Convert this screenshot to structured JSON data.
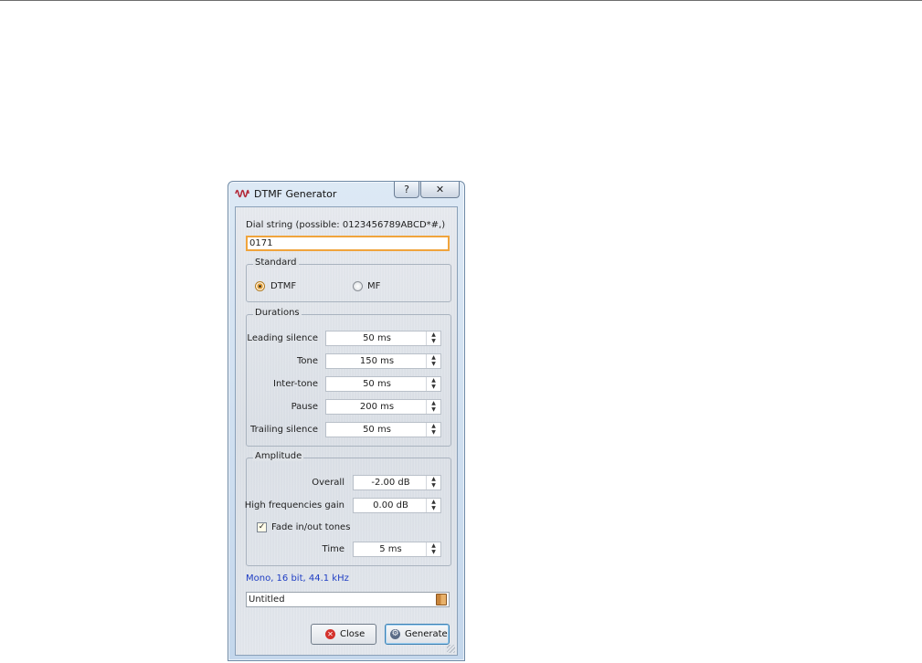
{
  "window": {
    "title": "DTMF Generator",
    "help_button": "?",
    "close_button": "✕"
  },
  "dial": {
    "label": "Dial string (possible: 0123456789ABCD*#,)",
    "value": "0171"
  },
  "standard": {
    "title": "Standard",
    "options": [
      {
        "label": "DTMF",
        "selected": true
      },
      {
        "label": "MF",
        "selected": false
      }
    ]
  },
  "durations": {
    "title": "Durations",
    "rows": [
      {
        "label": "Leading silence",
        "value": "50 ms"
      },
      {
        "label": "Tone",
        "value": "150 ms"
      },
      {
        "label": "Inter-tone",
        "value": "50 ms"
      },
      {
        "label": "Pause",
        "value": "200 ms"
      },
      {
        "label": "Trailing silence",
        "value": "50 ms"
      }
    ]
  },
  "amplitude": {
    "title": "Amplitude",
    "overall_label": "Overall",
    "overall_value": "-2.00 dB",
    "hf_label": "High frequencies gain",
    "hf_value": "0.00 dB",
    "fade_label": "Fade in/out tones",
    "fade_checked": true,
    "time_label": "Time",
    "time_value": "5 ms"
  },
  "format_text": "Mono, 16 bit, 44.1 kHz",
  "file_name": "Untitled",
  "buttons": {
    "close": "Close",
    "generate": "Generate"
  },
  "colors": {
    "accent_orange": "#f0a43c",
    "format_blue": "#1f3ec4",
    "close_icon_red": "#d4322c"
  }
}
